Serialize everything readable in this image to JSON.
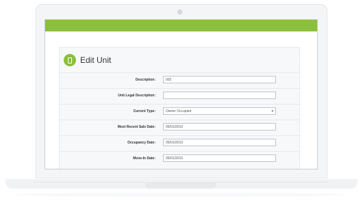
{
  "title": "Edit Unit",
  "fields": [
    {
      "label": "Description:",
      "value": "002",
      "type": "text"
    },
    {
      "label": "Unit Legal Description:",
      "value": "",
      "type": "text"
    },
    {
      "label": "Current Type:",
      "value": "Owner Occupied",
      "type": "select"
    },
    {
      "label": "Most Recent Sale Date:",
      "value": "05/01/2010",
      "type": "text"
    },
    {
      "label": "Occupancy Date:",
      "value": "05/01/2010",
      "type": "text"
    },
    {
      "label": "Move-In Date:",
      "value": "05/01/2010",
      "type": "text"
    }
  ],
  "icons": {
    "unit": "door-icon",
    "select": "chevron-down-icon"
  },
  "colors": {
    "accent": "#8bbf3d"
  }
}
